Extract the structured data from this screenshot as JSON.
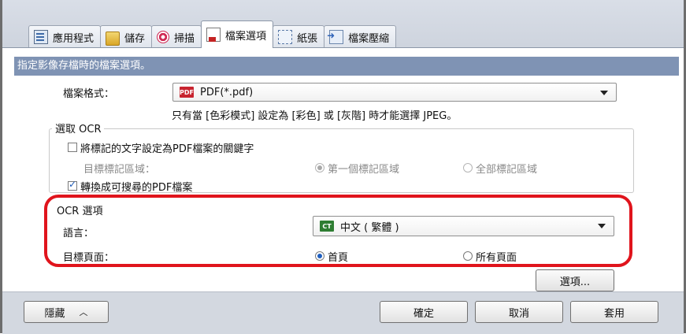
{
  "tabs": [
    {
      "label": "應用程式",
      "icon": "application-icon"
    },
    {
      "label": "儲存",
      "icon": "save-folder-icon"
    },
    {
      "label": "掃描",
      "icon": "scan-icon"
    },
    {
      "label": "檔案選項",
      "icon": "file-options-icon",
      "active": true
    },
    {
      "label": "紙張",
      "icon": "paper-icon"
    },
    {
      "label": "檔案壓縮",
      "icon": "compression-icon"
    }
  ],
  "header": {
    "title": "指定影像存檔時的檔案選項。"
  },
  "file_format": {
    "label": "檔案格式：",
    "value": "PDF(*.pdf)",
    "badge": "PDF",
    "note": "只有當 [色彩模式] 設定為 [彩色] 或 [灰階] 時才能選擇 JPEG。"
  },
  "ocr_selection": {
    "title": "選取 OCR",
    "keyword_checkbox": {
      "label": "將標記的文字設定為PDF檔案的關鍵字",
      "checked": false
    },
    "target_area_label": "目標標記區域：",
    "target_area_options": [
      {
        "label": "第一個標記區域",
        "selected": true
      },
      {
        "label": "全部標記區域",
        "selected": false
      }
    ],
    "searchable_checkbox": {
      "label": "轉換成可搜尋的PDF檔案",
      "checked": true
    }
  },
  "ocr_options": {
    "title": "OCR 選項",
    "language_label": "語言：",
    "language_value": "中文 ( 繁體 )",
    "language_badge": "CT",
    "target_page_label": "目標頁面：",
    "target_page_options": [
      {
        "label": "首頁",
        "selected": true
      },
      {
        "label": "所有頁面",
        "selected": false
      }
    ]
  },
  "options_button": "選項...",
  "footer": {
    "hide_label": "隱藏",
    "ok_label": "確定",
    "cancel_label": "取消",
    "apply_label": "套用"
  },
  "colors": {
    "header_strip": "#7f93b4",
    "highlight_box": "#e0141c",
    "tab_bar": "#d3d8e0"
  }
}
